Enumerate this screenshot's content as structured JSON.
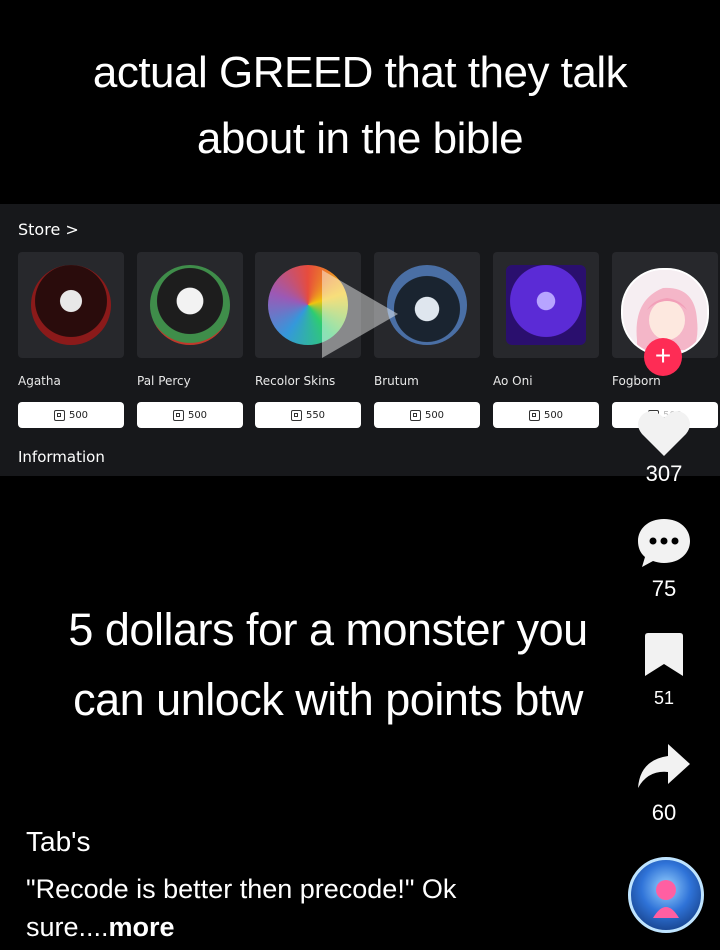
{
  "overlay": {
    "top_caption_line1": "actual GREED that they talk",
    "top_caption_line2": "about in the bible",
    "mid_caption_line1": "5 dollars for a monster you",
    "mid_caption_line2": "can unlock with points btw"
  },
  "store": {
    "header": "Store >",
    "info_label": "Information",
    "items": [
      {
        "name": "Agatha",
        "price": "500",
        "color": "#c0392b"
      },
      {
        "name": "Pal Percy",
        "price": "500",
        "color": "#3f8d4a"
      },
      {
        "name": "Recolor Skins",
        "price": "550",
        "color": "#9b59b6"
      },
      {
        "name": "Brutum",
        "price": "500",
        "color": "#4a6fa5"
      },
      {
        "name": "Ao Oni",
        "price": "500",
        "color": "#5b2bd6"
      },
      {
        "name": "Fogborn",
        "price": "500",
        "color": "#888888"
      }
    ]
  },
  "rail": {
    "likes": "307",
    "comments": "75",
    "saves": "51",
    "shares": "60",
    "follow_symbol": "+"
  },
  "post": {
    "author": "Tab's",
    "description": "\"Recode is better then precode!\" Ok sure....",
    "more_label": "more"
  },
  "icons": [
    "play-icon",
    "heart-icon",
    "comment-icon",
    "bookmark-icon",
    "share-icon",
    "robux-icon",
    "music-disc-icon"
  ]
}
